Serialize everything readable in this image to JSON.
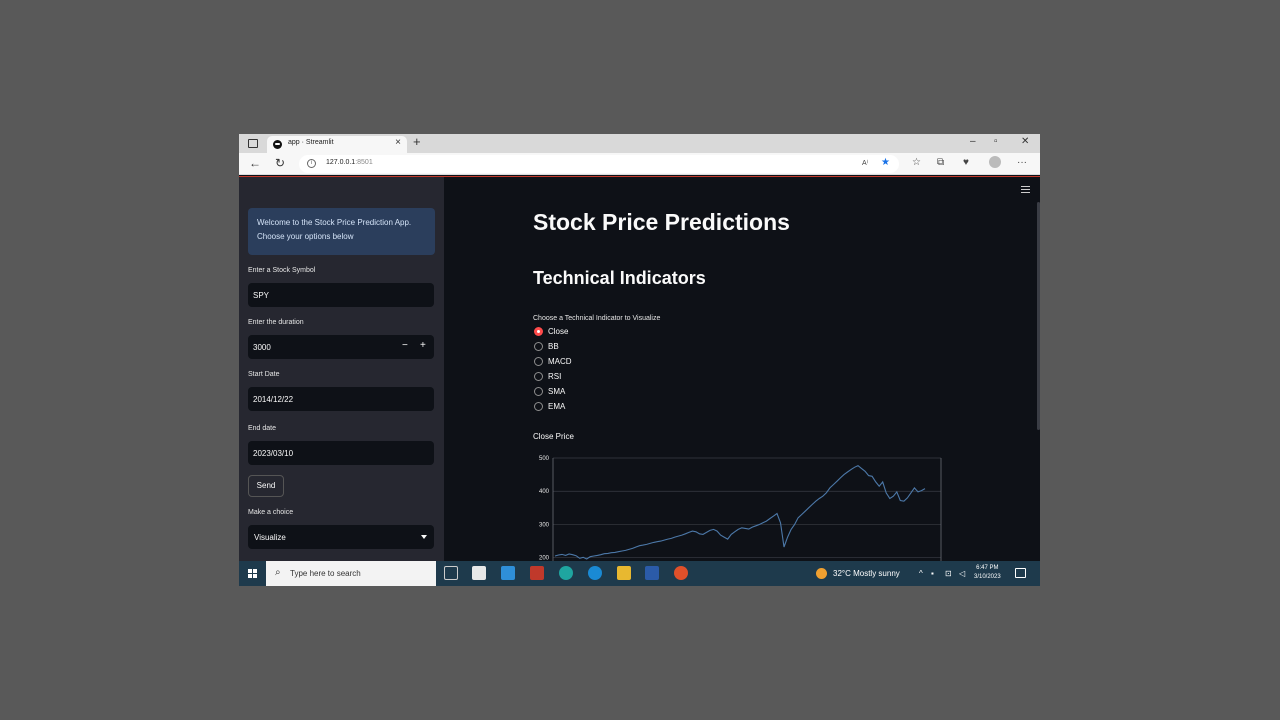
{
  "browser": {
    "tab_title": "app · Streamlit",
    "tab_close": "×",
    "new_tab": "+",
    "window_controls": {
      "minimize": "–",
      "restore": "▫",
      "close": "✕"
    },
    "url_host": "127.0.0.1",
    "url_port": ":8501",
    "read_aloud": "A⁾",
    "more": "···"
  },
  "sidebar": {
    "welcome_text": "Welcome to the Stock Price Prediction App. Choose your options below",
    "symbol": {
      "label": "Enter a Stock Symbol",
      "value": "SPY"
    },
    "duration": {
      "label": "Enter the duration",
      "value": "3000",
      "minus": "−",
      "plus": "+"
    },
    "start_date": {
      "label": "Start Date",
      "value": "2014/12/22"
    },
    "end_date": {
      "label": "End date",
      "value": "2023/03/10"
    },
    "send_label": "Send",
    "choice": {
      "label": "Make a choice",
      "value": "Visualize"
    }
  },
  "main": {
    "title": "Stock Price Predictions",
    "subtitle": "Technical Indicators",
    "radio_label": "Choose a Technical Indicator to Visualize",
    "radio_options": [
      "Close",
      "BB",
      "MACD",
      "RSI",
      "SMA",
      "EMA"
    ],
    "selected_option": "Close",
    "chart_title": "Close Price"
  },
  "chart_data": {
    "type": "line",
    "title": "Close Price",
    "xlabel": "",
    "ylabel": "",
    "ylim": [
      190,
      500
    ],
    "y_ticks": [
      200,
      300,
      400,
      500
    ],
    "grid": true,
    "color": "#4c78a8",
    "series": [
      {
        "values": [
          205,
          208,
          210,
          207,
          211,
          209,
          206,
          198,
          201,
          196,
          203,
          205,
          207,
          209,
          212,
          213,
          215,
          216,
          218,
          220,
          222,
          225,
          228,
          232,
          236,
          238,
          240,
          243,
          246,
          248,
          250,
          253,
          256,
          258,
          262,
          265,
          268,
          272,
          276,
          280,
          278,
          272,
          270,
          276,
          282,
          285,
          280,
          268,
          262,
          256,
          270,
          278,
          285,
          290,
          288,
          286,
          292,
          296,
          300,
          305,
          310,
          318,
          325,
          333,
          305,
          232,
          262,
          285,
          300,
          320,
          330,
          340,
          350,
          360,
          370,
          378,
          385,
          395,
          410,
          420,
          430,
          440,
          450,
          458,
          465,
          472,
          477,
          468,
          460,
          447,
          445,
          428,
          415,
          428,
          395,
          378,
          385,
          398,
          372,
          370,
          380,
          395,
          410,
          398,
          402,
          408
        ]
      }
    ]
  },
  "taskbar": {
    "search_placeholder": "Type here to search",
    "weather": "32°C  Mostly sunny",
    "time": "6:47 PM",
    "date": "3/10/2023"
  }
}
